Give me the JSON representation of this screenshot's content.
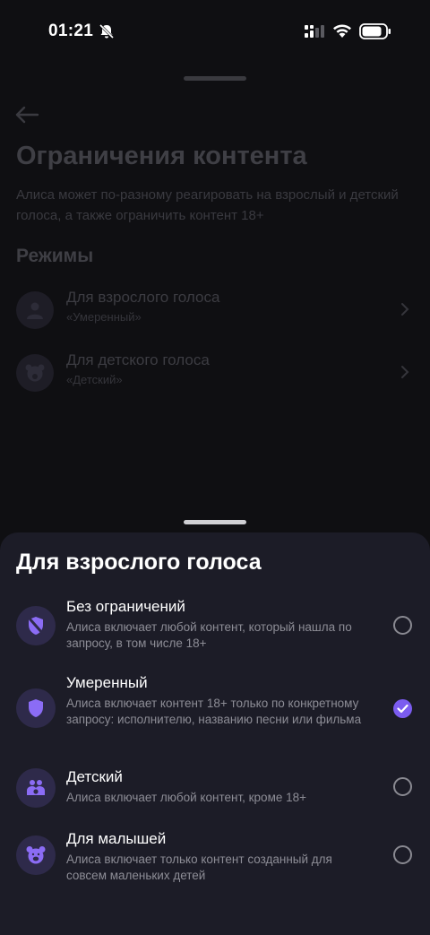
{
  "status_bar": {
    "time": "01:21"
  },
  "background": {
    "title": "Ограничения контента",
    "description": "Алиса может по-разному реагировать на взрослый и детский голоса, а также ограничить контент 18+",
    "section": "Режимы",
    "rows": [
      {
        "title": "Для взрослого голоса",
        "subtitle": "«Умеренный»",
        "icon": "person-icon"
      },
      {
        "title": "Для детского голоса",
        "subtitle": "«Детский»",
        "icon": "bear-icon"
      }
    ]
  },
  "sheet": {
    "title": "Для взрослого голоса",
    "options": [
      {
        "title": "Без ограничений",
        "description": "Алиса включает любой контент, который нашла по запросу, в том числе 18+",
        "icon": "shield-off-icon",
        "selected": false
      },
      {
        "title": "Умеренный",
        "description": "Алиса включает контент 18+ только по конкретному запросу: исполнителю, названию песни или фильма",
        "icon": "shield-icon",
        "selected": true
      },
      {
        "title": "Детский",
        "description": "Алиса включает любой контент, кроме 18+",
        "icon": "family-icon",
        "selected": false
      },
      {
        "title": "Для малышей",
        "description": "Алиса включает только контент созданный для совсем маленьких детей",
        "icon": "bear-icon",
        "selected": false
      }
    ]
  },
  "colors": {
    "accent": "#7b5cf0",
    "sheet_bg": "#1c1c27",
    "icon_bg": "#2e2a4a",
    "icon_fg": "#8b6cf5"
  }
}
